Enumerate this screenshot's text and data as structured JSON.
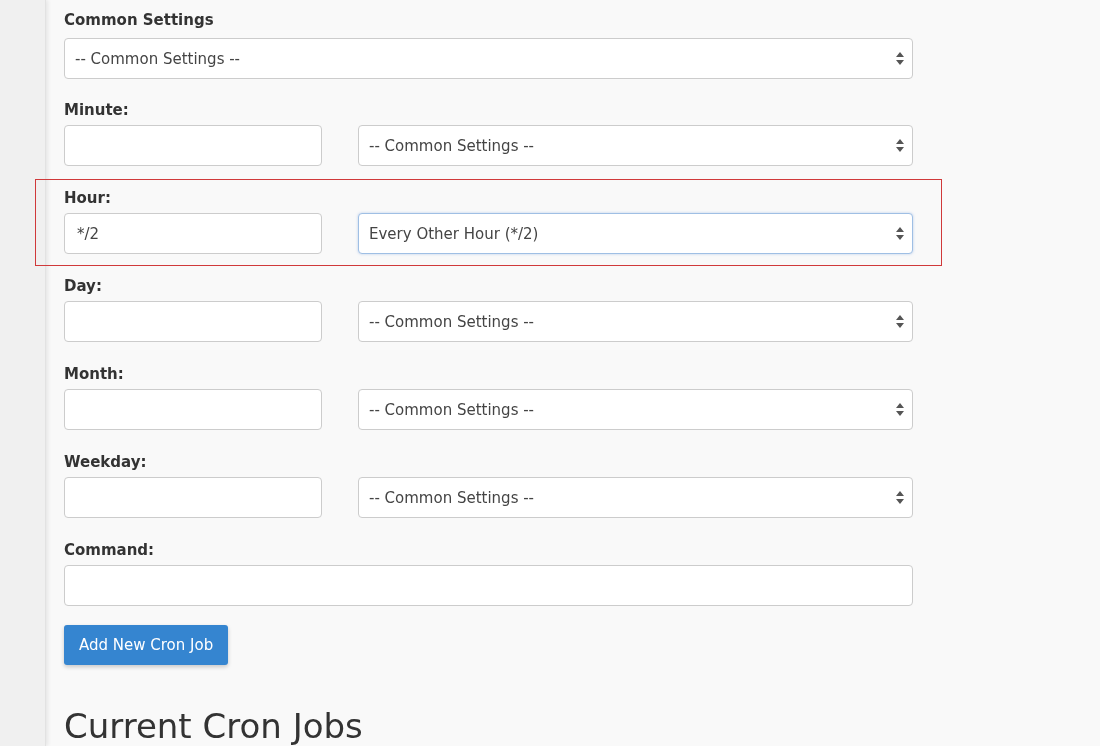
{
  "common_settings": {
    "label": "Common Settings",
    "select": {
      "value": "-- Common Settings --",
      "focused": false
    }
  },
  "fields": [
    {
      "label": "Minute:",
      "highlighted": false,
      "select": {
        "value": "-- Common Settings --",
        "focused": false
      }
    },
    {
      "label": "Hour:",
      "value": "*/2",
      "highlighted": true,
      "select": {
        "value": "Every Other Hour (*/2)",
        "focused": true
      }
    },
    {
      "label": "Day:",
      "highlighted": false,
      "select": {
        "value": "-- Common Settings --",
        "focused": false
      }
    },
    {
      "label": "Month:",
      "highlighted": false,
      "select": {
        "value": "-- Common Settings --",
        "focused": false
      }
    },
    {
      "label": "Weekday:",
      "highlighted": false,
      "select": {
        "value": "-- Common Settings --",
        "focused": false
      }
    }
  ],
  "command": {
    "label": "Command:"
  },
  "button": "Add New Cron Job",
  "heading": "Current Cron Jobs"
}
